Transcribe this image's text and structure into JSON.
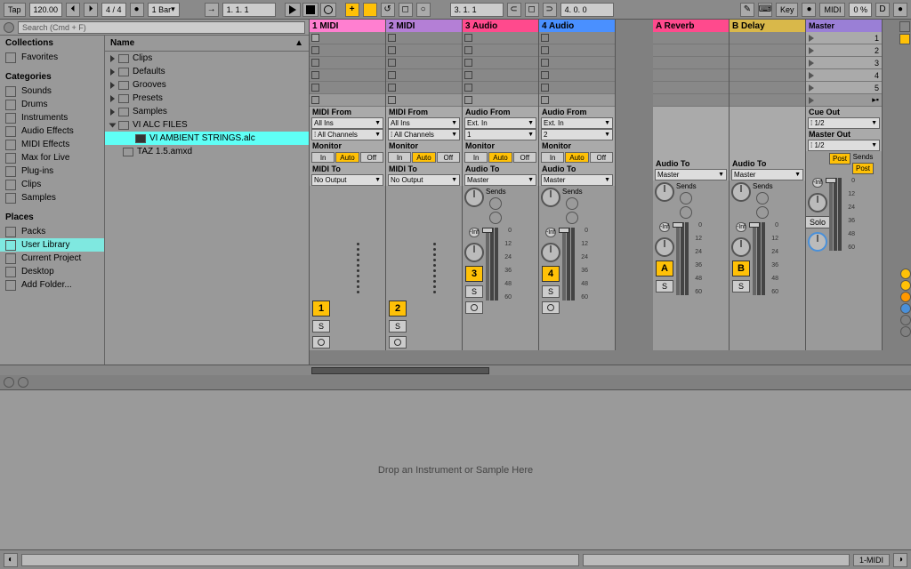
{
  "topbar": {
    "tap": "Tap",
    "tempo": "120.00",
    "sig": "4 / 4",
    "metro": "1 Bar",
    "pos": "1. 1. 1",
    "loop_start": "3. 1. 1",
    "loop_len": "4. 0. 0",
    "key": "Key",
    "midi": "MIDI",
    "cpu": "0 %",
    "disc": "D"
  },
  "search": {
    "placeholder": "Search (Cmd + F)"
  },
  "browser": {
    "collections": "Collections",
    "favorites": "Favorites",
    "categories": "Categories",
    "cats": [
      "Sounds",
      "Drums",
      "Instruments",
      "Audio Effects",
      "MIDI Effects",
      "Max for Live",
      "Plug-ins",
      "Clips",
      "Samples"
    ],
    "places": "Places",
    "place_items": [
      "Packs",
      "User Library",
      "Current Project",
      "Desktop",
      "Add Folder..."
    ],
    "name": "Name",
    "tree": [
      "Clips",
      "Defaults",
      "Grooves",
      "Presets",
      "Samples",
      "VI ALC FILES"
    ],
    "sel_file": "VI AMBIENT STRINGS.alc",
    "taz": "TAZ 1.5.amxd"
  },
  "tracks": [
    {
      "name": "1 MIDI",
      "color": "#ff7fd0",
      "type": "midi",
      "num": "1",
      "from": "MIDI From",
      "in": "All Ins",
      "ch": "All Channels",
      "to": "MIDI To",
      "out": "No Output"
    },
    {
      "name": "2 MIDI",
      "color": "#b47fd6",
      "type": "midi",
      "num": "2",
      "from": "MIDI From",
      "in": "All Ins",
      "ch": "All Channels",
      "to": "MIDI To",
      "out": "No Output"
    },
    {
      "name": "3 Audio",
      "color": "#ff4a8d",
      "type": "audio",
      "num": "3",
      "from": "Audio From",
      "in": "Ext. In",
      "ch": "1",
      "to": "Audio To",
      "out": "Master"
    },
    {
      "name": "4 Audio",
      "color": "#4a90ff",
      "type": "audio",
      "num": "4",
      "from": "Audio From",
      "in": "Ext. In",
      "ch": "2",
      "to": "Audio To",
      "out": "Master"
    }
  ],
  "returns": [
    {
      "name": "A Reverb",
      "color": "#ff4a8d",
      "num": "A",
      "to": "Audio To",
      "out": "Master"
    },
    {
      "name": "B Delay",
      "color": "#d9b84a",
      "num": "B",
      "to": "Audio To",
      "out": "Master"
    }
  ],
  "master": {
    "name": "Master",
    "color": "#9a7fd6",
    "cue": "Cue Out",
    "cueval": "1/2",
    "mout": "Master Out",
    "moutval": "1/2",
    "solo": "Solo"
  },
  "scenes": [
    "1",
    "2",
    "3",
    "4",
    "5"
  ],
  "labels": {
    "monitor": "Monitor",
    "in": "In",
    "auto": "Auto",
    "off": "Off",
    "sends": "Sends",
    "inf": "-Inf",
    "post": "Post",
    "db": [
      "0",
      "12",
      "24",
      "36",
      "48",
      "60"
    ],
    "s": "S"
  },
  "device_drop": "Drop an Instrument or Sample Here",
  "bottom": {
    "track": "1-MIDI"
  }
}
